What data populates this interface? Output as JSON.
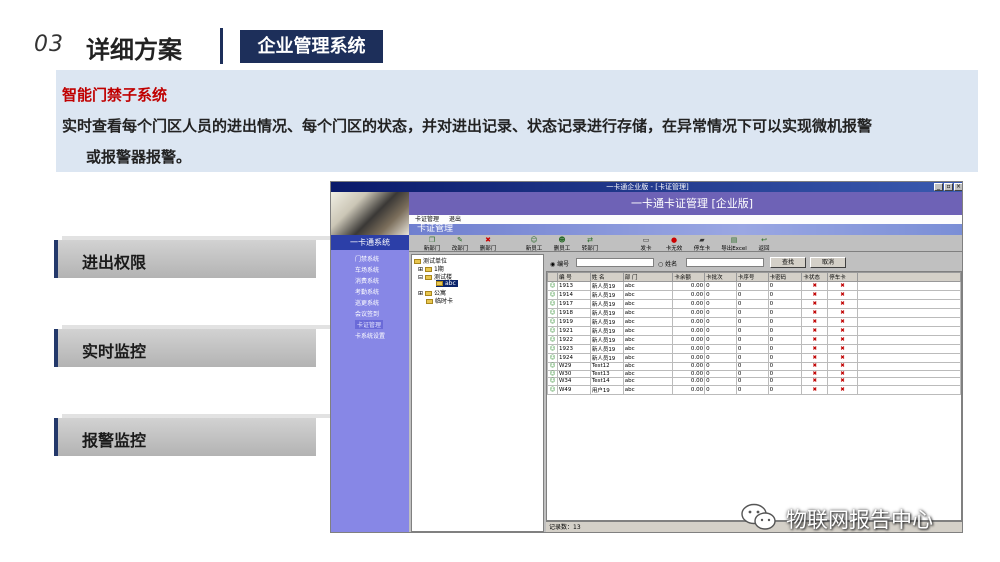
{
  "header": {
    "section_number": "03",
    "section_title": "详细方案",
    "tag": "企业管理系统"
  },
  "description": {
    "title": "智能门禁子系统",
    "line1": "实时查看每个门区人员的进出情况、每个门区的状态，并对进出记录、状态记录进行存储，在异常情况下可以实现微机报警",
    "line2": "或报警器报警。"
  },
  "features": [
    {
      "label": "进出权限"
    },
    {
      "label": "实时监控"
    },
    {
      "label": "报警监控"
    }
  ],
  "app": {
    "window_title": "一卡通企业版 - [卡证管理]",
    "window_buttons": [
      "_",
      "▫",
      "×"
    ],
    "banner_title": "一卡通卡证管理 [企业版]",
    "menu": [
      "卡证管理",
      "退出"
    ],
    "section_label": "卡证管理",
    "sidebar_header": "一卡通系统",
    "sidebar_items": [
      "门禁系统",
      "车场系统",
      "消费系统",
      "考勤系统",
      "巡更系统",
      "会议签到",
      "卡证管理",
      "卡系统设置"
    ],
    "sidebar_active": 6,
    "toolbar": [
      "新部门",
      "改部门",
      "删部门",
      "新员工",
      "删员工",
      "转部门",
      "发卡",
      "卡无效",
      "停车卡",
      "导出Excel",
      "返回"
    ],
    "tree": {
      "root": "测试单位",
      "nodes": [
        "1期",
        "测试楼",
        "abc",
        "公寓",
        "临时卡"
      ]
    },
    "search": {
      "option1": "编号",
      "option2": "姓名",
      "query_button": "查找",
      "cancel_button": "取消"
    },
    "grid": {
      "columns": [
        "编 号",
        "姓 名",
        "部 门",
        "卡余额",
        "卡批次",
        "卡序号",
        "卡密码",
        "卡状态",
        "停车卡"
      ],
      "rows": [
        [
          "1913",
          "新人员19",
          "abc",
          "0.00",
          "0",
          "0",
          "0"
        ],
        [
          "1914",
          "新人员19",
          "abc",
          "0.00",
          "0",
          "0",
          "0"
        ],
        [
          "1917",
          "新人员19",
          "abc",
          "0.00",
          "0",
          "0",
          "0"
        ],
        [
          "1918",
          "新人员19",
          "abc",
          "0.00",
          "0",
          "0",
          "0"
        ],
        [
          "1919",
          "新人员19",
          "abc",
          "0.00",
          "0",
          "0",
          "0"
        ],
        [
          "1921",
          "新人员19",
          "abc",
          "0.00",
          "0",
          "0",
          "0"
        ],
        [
          "1922",
          "新人员19",
          "abc",
          "0.00",
          "0",
          "0",
          "0"
        ],
        [
          "1923",
          "新人员19",
          "abc",
          "0.00",
          "0",
          "0",
          "0"
        ],
        [
          "1924",
          "新人员19",
          "abc",
          "0.00",
          "0",
          "0",
          "0"
        ],
        [
          "W29",
          "Test12",
          "abc",
          "0.00",
          "0",
          "0",
          "0"
        ],
        [
          "W30",
          "Test13",
          "abc",
          "0.00",
          "0",
          "0",
          "0"
        ],
        [
          "W34",
          "Test14",
          "abc",
          "0.00",
          "0",
          "0",
          "0"
        ],
        [
          "W49",
          "用户19",
          "abc",
          "0.00",
          "0",
          "0",
          "0"
        ]
      ]
    },
    "status_text": "记录数：13"
  },
  "watermark": {
    "text": "物联网报告中心"
  }
}
